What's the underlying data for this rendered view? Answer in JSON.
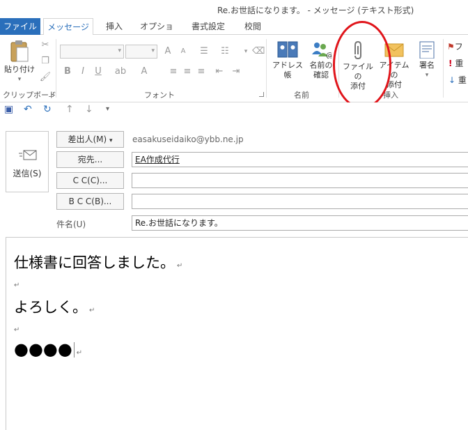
{
  "window": {
    "title": "Re.お世話になります。 - メッセージ (テキスト形式)"
  },
  "tabs": [
    {
      "label": "ファイル"
    },
    {
      "label": "メッセージ"
    },
    {
      "label": "挿入"
    },
    {
      "label": "オプション"
    },
    {
      "label": "書式設定"
    },
    {
      "label": "校閲"
    }
  ],
  "ribbon": {
    "clipboard": {
      "paste_label": "貼り付け",
      "group_label": "クリップボード"
    },
    "font": {
      "group_label": "フォント"
    },
    "names": {
      "address_book_label": "アドレス帳",
      "check_names_line1": "名前の",
      "check_names_line2": "確認",
      "group_label": "名前"
    },
    "include": {
      "attach_file_line1": "ファイルの",
      "attach_file_line2": "添付",
      "attach_item_line1": "アイテムの",
      "attach_item_line2": "添付",
      "signature_label": "署名",
      "group_label": "挿入"
    },
    "tags": {
      "item1": "フ",
      "item2": "重",
      "item3": "重"
    }
  },
  "message": {
    "send_label": "送信(S)",
    "from_button": "差出人(M)",
    "from_value": "easakuseidaiko@ybb.ne.jp",
    "to_button": "宛先...",
    "to_value": "EA作成代行",
    "cc_button": "C C(C)...",
    "cc_value": "",
    "bcc_button": "B C C(B)...",
    "bcc_value": "",
    "subject_label": "件名(U)",
    "subject_value": "Re.お世話になります。"
  },
  "body": {
    "line1": "仕様書に回答しました。",
    "line2": "よろしく。",
    "line3": "●●●●",
    "mark": "↵"
  },
  "colors": {
    "accent": "#2a6fbb",
    "annotation": "#e0141a"
  }
}
